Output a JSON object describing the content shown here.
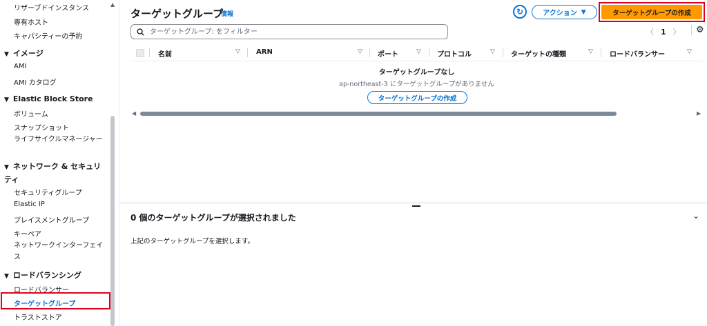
{
  "sidebar": {
    "items_top": [
      "リザーブドインスタンス",
      "専有ホスト",
      "キャパシティーの予約"
    ],
    "images": {
      "title": "イメージ",
      "items": [
        "AMI",
        "AMI カタログ"
      ]
    },
    "ebs": {
      "title": "Elastic Block Store",
      "items": [
        "ボリューム",
        "スナップショット",
        "ライフサイクルマネージャー"
      ]
    },
    "network": {
      "title": "ネットワーク & セキュリティ",
      "items": [
        "セキュリティグループ",
        "Elastic IP",
        "プレイスメントグループ",
        "キーペア",
        "ネットワークインターフェイス"
      ]
    },
    "lb": {
      "title": "ロードバランシング",
      "items": [
        "ロードバランサー",
        "ターゲットグループ",
        "トラストストア"
      ]
    }
  },
  "main": {
    "title": "ターゲットグループ",
    "info_link": "情報",
    "action_label": "アクション",
    "create_label": "ターゲットグループの作成",
    "search_placeholder": "ターゲットグループ: をフィルター",
    "page": "1",
    "columns": [
      "名前",
      "ARN",
      "ポート",
      "プロトコル",
      "ターゲットの種類",
      "ロードバランサー"
    ],
    "empty": {
      "title": "ターゲットグループなし",
      "desc": "ap-northeast-3 にターゲットグループがありません",
      "button": "ターゲットグループの作成"
    }
  },
  "detail": {
    "title": "0 個のターゲットグループが選択されました",
    "desc": "上記のターゲットグループを選択します。"
  },
  "colors": {
    "accent": "#0972d3",
    "primary": "#ff9900",
    "highlight": "#e0001b"
  }
}
